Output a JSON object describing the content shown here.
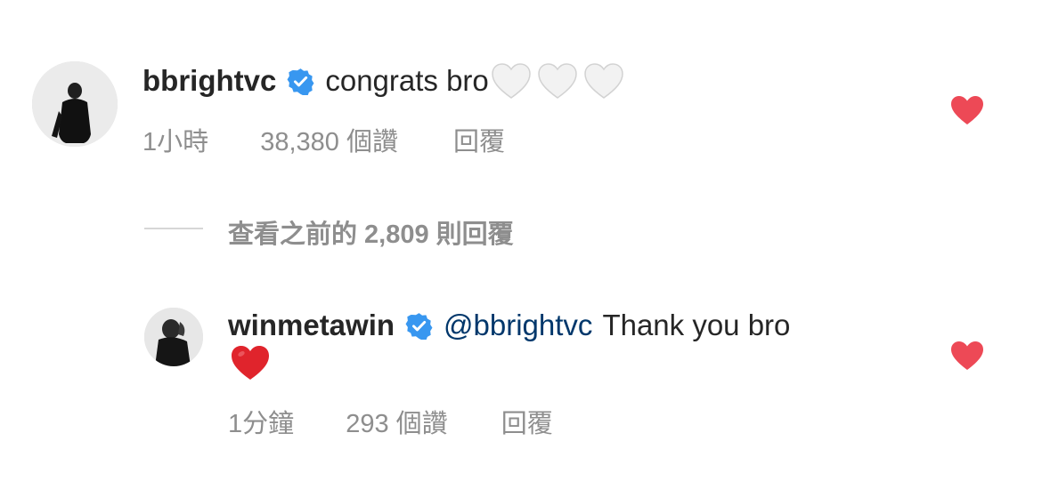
{
  "comments": [
    {
      "username": "bbrightvc",
      "verified": true,
      "mention": "",
      "text": "congrats bro",
      "emojis": [
        "white-heart",
        "white-heart",
        "white-heart"
      ],
      "time": "1小時",
      "likes": "38,380 個讚",
      "reply_label": "回覆",
      "liked": true
    },
    {
      "username": "winmetawin",
      "verified": true,
      "mention": "@bbrightvc",
      "text": "Thank you bro",
      "emojis": [
        "red-heart"
      ],
      "time": "1分鐘",
      "likes": "293 個讚",
      "reply_label": "回覆",
      "liked": true
    }
  ],
  "view_replies": {
    "label": "查看之前的 2,809 則回覆"
  },
  "colors": {
    "text": "#262626",
    "secondary": "#8e8e8e",
    "mention": "#00376b",
    "verified": "#3897f0",
    "like": "#ed4956",
    "divider": "#d6d6d6"
  }
}
